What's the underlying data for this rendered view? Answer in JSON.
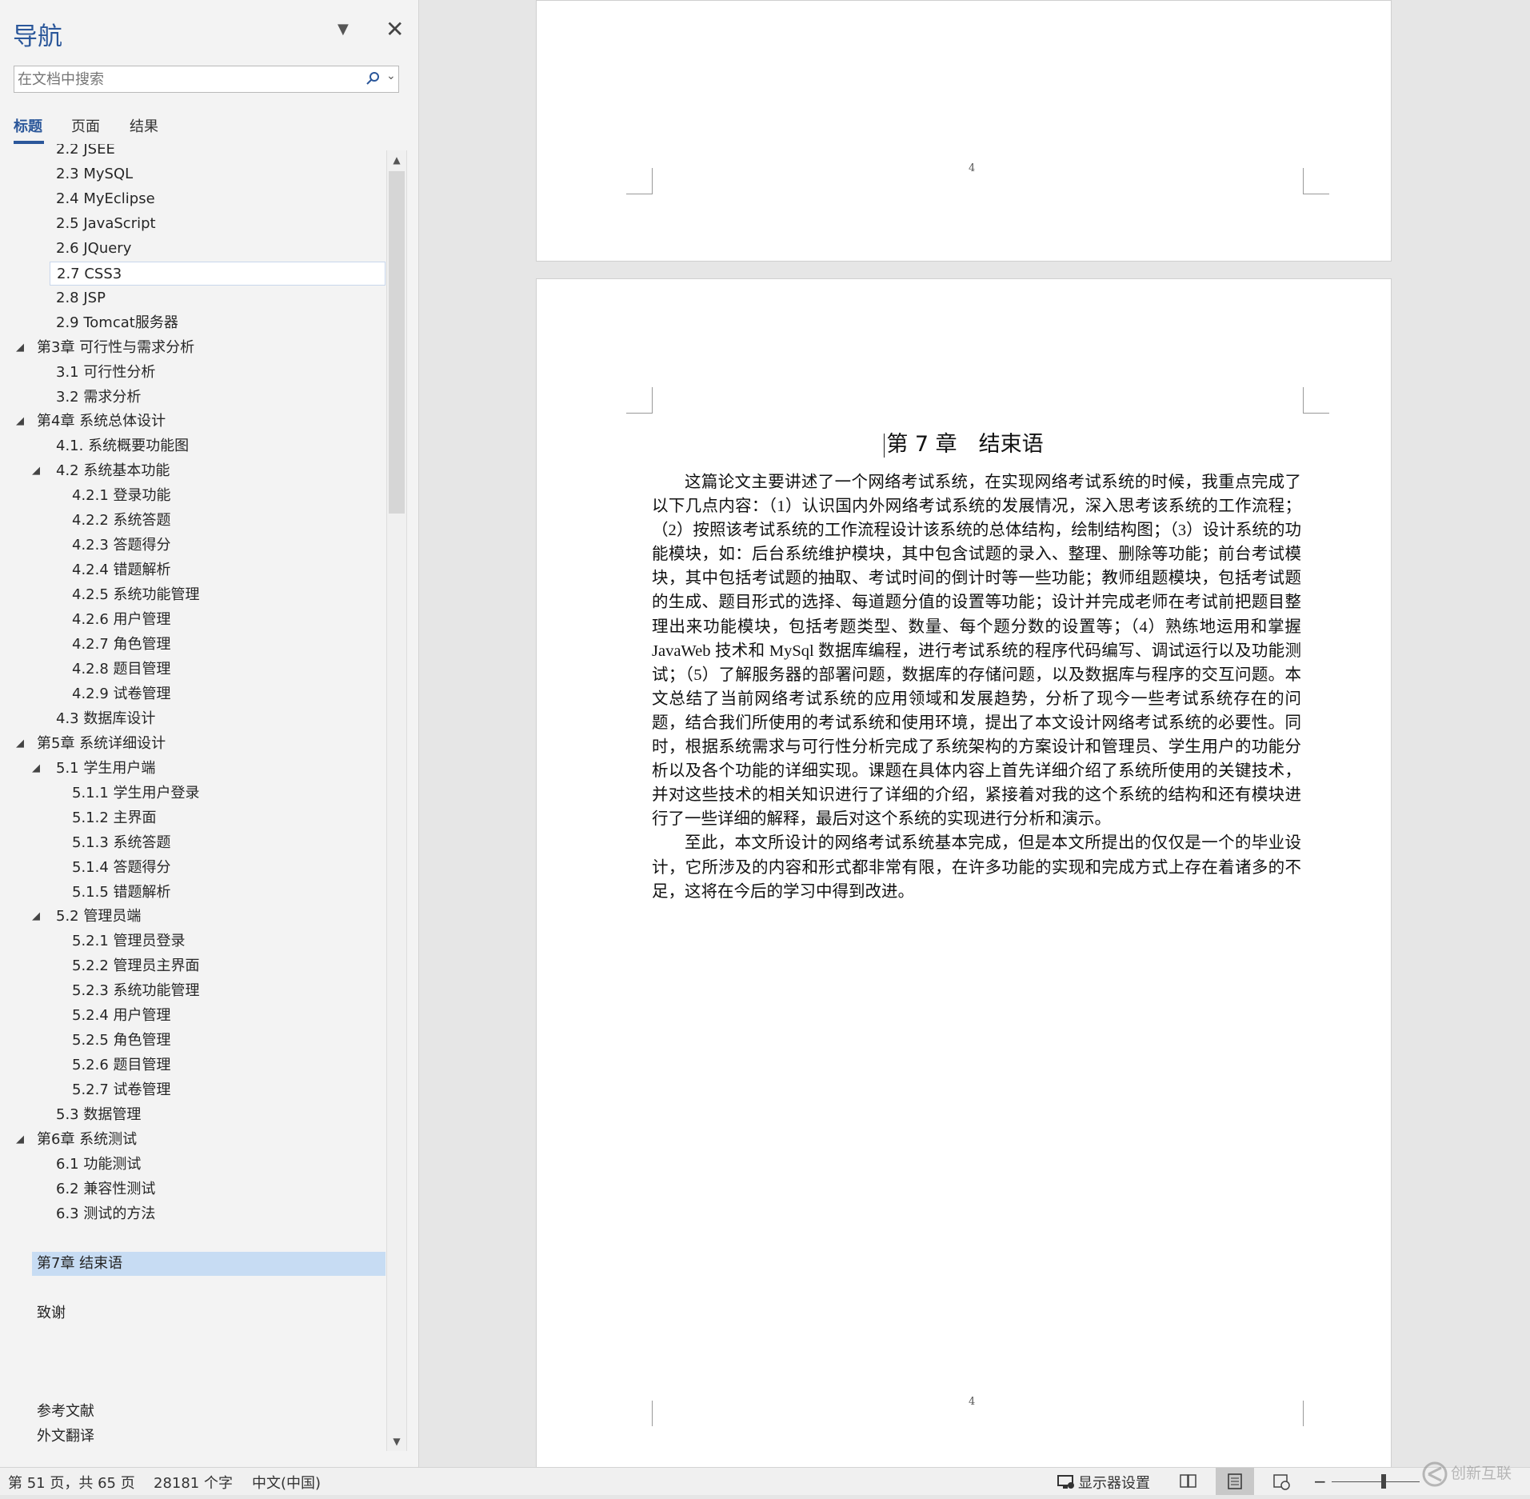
{
  "nav": {
    "title": "导航",
    "search_placeholder": "在文档中搜索",
    "tabs": [
      "标题",
      "页面",
      "结果"
    ],
    "items": [
      {
        "text": "2.2  JSEE",
        "level": 2
      },
      {
        "text": "2.3  MySQL",
        "level": 2
      },
      {
        "text": "2.4  MyEclipse",
        "level": 2
      },
      {
        "text": "2.5  JavaScript",
        "level": 2
      },
      {
        "text": "2.6  JQuery",
        "level": 2
      },
      {
        "text": "2.7  CSS3",
        "level": 2,
        "state": "hover"
      },
      {
        "text": "2.8  JSP",
        "level": 2
      },
      {
        "text": "2.9  Tomcat服务器",
        "level": 2
      },
      {
        "text": "第3章  可行性与需求分析",
        "level": 1,
        "expanded": true
      },
      {
        "text": "3.1  可行性分析",
        "level": 2
      },
      {
        "text": "3.2  需求分析",
        "level": 2
      },
      {
        "text": "第4章  系统总体设计",
        "level": 1,
        "expanded": true
      },
      {
        "text": "4.1.  系统概要功能图",
        "level": 2
      },
      {
        "text": "4.2  系统基本功能",
        "level": 2,
        "expanded": true
      },
      {
        "text": "4.2.1  登录功能",
        "level": 3
      },
      {
        "text": "4.2.2  系统答题",
        "level": 3
      },
      {
        "text": "4.2.3  答题得分",
        "level": 3
      },
      {
        "text": "4.2.4  错题解析",
        "level": 3
      },
      {
        "text": "4.2.5  系统功能管理",
        "level": 3
      },
      {
        "text": "4.2.6  用户管理",
        "level": 3
      },
      {
        "text": "4.2.7  角色管理",
        "level": 3
      },
      {
        "text": "4.2.8  题目管理",
        "level": 3
      },
      {
        "text": "4.2.9  试卷管理",
        "level": 3
      },
      {
        "text": "4.3  数据库设计",
        "level": 2
      },
      {
        "text": "第5章  系统详细设计",
        "level": 1,
        "expanded": true
      },
      {
        "text": "5.1  学生用户端",
        "level": 2,
        "expanded": true
      },
      {
        "text": "5.1.1  学生用户登录",
        "level": 3
      },
      {
        "text": "5.1.2  主界面",
        "level": 3
      },
      {
        "text": "5.1.3  系统答题",
        "level": 3
      },
      {
        "text": "5.1.4  答题得分",
        "level": 3
      },
      {
        "text": "5.1.5  错题解析",
        "level": 3
      },
      {
        "text": "5.2  管理员端",
        "level": 2,
        "expanded": true
      },
      {
        "text": "5.2.1  管理员登录",
        "level": 3
      },
      {
        "text": "5.2.2  管理员主界面",
        "level": 3
      },
      {
        "text": "5.2.3  系统功能管理",
        "level": 3
      },
      {
        "text": "5.2.4  用户管理",
        "level": 3
      },
      {
        "text": "5.2.5  角色管理",
        "level": 3
      },
      {
        "text": "5.2.6  题目管理",
        "level": 3
      },
      {
        "text": "5.2.7  试卷管理",
        "level": 3
      },
      {
        "text": "5.3  数据管理",
        "level": 2
      },
      {
        "text": "第6章  系统测试",
        "level": 1,
        "expanded": true
      },
      {
        "text": "6.1  功能测试",
        "level": 2
      },
      {
        "text": "6.2  兼容性测试",
        "level": 2
      },
      {
        "text": "6.3  测试的方法",
        "level": 2
      },
      {
        "text": "",
        "level": 1
      },
      {
        "text": "第7章  结束语",
        "level": 1,
        "state": "selected"
      },
      {
        "text": "",
        "level": 1
      },
      {
        "text": "致谢",
        "level": 1
      },
      {
        "text": "",
        "level": 1
      },
      {
        "text": "",
        "level": 1
      },
      {
        "text": "",
        "level": 1
      },
      {
        "text": "参考文献",
        "level": 1
      },
      {
        "text": "外文翻译",
        "level": 1
      }
    ]
  },
  "document": {
    "page_number_top": "4",
    "page_number_bottom": "4",
    "chapter_title": "第 7 章　结束语",
    "paragraphs": [
      "这篇论文主要讲述了一个网络考试系统，在实现网络考试系统的时候，我重点完成了以下几点内容：（1）认识国内外网络考试系统的发展情况，深入思考该系统的工作流程；（2）按照该考试系统的工作流程设计该系统的总体结构，绘制结构图；（3）设计系统的功能模块，如：后台系统维护模块，其中包含试题的录入、整理、删除等功能；前台考试模块，其中包括考试题的抽取、考试时间的倒计时等一些功能；教师组题模块，包括考试题的生成、题目形式的选择、每道题分值的设置等功能；设计并完成老师在考试前把题目整理出来功能模块，包括考题类型、数量、每个题分数的设置等；（4）熟练地运用和掌握 JavaWeb 技术和 MySql 数据库编程，进行考试系统的程序代码编写、调试运行以及功能测试；（5）了解服务器的部署问题，数据库的存储问题，以及数据库与程序的交互问题。本文总结了当前网络考试系统的应用领域和发展趋势，分析了现今一些考试系统存在的问题，结合我们所使用的考试系统和使用环境，提出了本文设计网络考试系统的必要性。同时，根据系统需求与可行性分析完成了系统架构的方案设计和管理员、学生用户的功能分析以及各个功能的详细实现。课题在具体内容上首先详细介绍了系统所使用的关键技术，并对这些技术的相关知识进行了详细的介绍，紧接着对我的这个系统的结构和还有模块进行了一些详细的解释，最后对这个系统的实现进行分析和演示。",
      "至此，本文所设计的网络考试系统基本完成，但是本文所提出的仅仅是一个的毕业设计，它所涉及的内容和形式都非常有限，在许多功能的实现和完成方式上存在着诸多的不足，这将在今后的学习中得到改进。"
    ]
  },
  "status": {
    "page_info": "第 51 页，共 65 页",
    "word_count": "28181 个字",
    "language": "中文(中国)",
    "display_settings": "显示器设置",
    "zoom_minus": "−"
  },
  "icons": {
    "close": "close-icon",
    "dropdown": "chevron-down-icon",
    "search": "search-icon",
    "read_mode": "read-mode-icon",
    "print_layout": "print-layout-icon",
    "web_layout": "web-layout-icon",
    "display": "display-settings-icon"
  },
  "colors": {
    "accent": "#2b579a",
    "selected": "#c7dcf3"
  }
}
